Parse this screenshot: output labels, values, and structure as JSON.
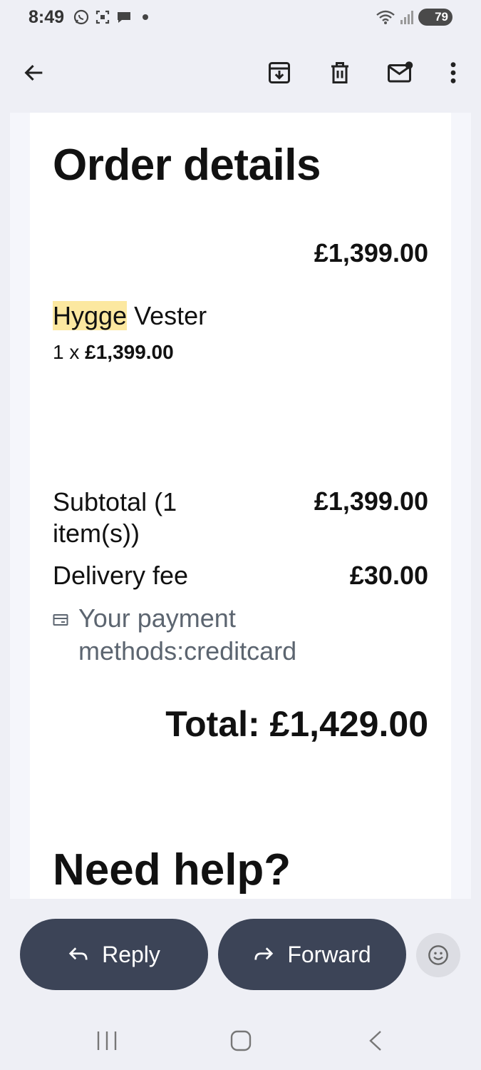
{
  "status_bar": {
    "time": "8:49",
    "battery": "79",
    "left_icons": [
      "whatsapp-icon",
      "screenshot-icon",
      "chat-icon",
      "dot-icon"
    ],
    "right_icons": [
      "wifi-icon",
      "signal-icon",
      "battery-icon"
    ]
  },
  "toolbar": {
    "icons": [
      "back-arrow-icon",
      "archive-icon",
      "delete-icon",
      "mark-unread-icon",
      "more-icon"
    ]
  },
  "email": {
    "heading": "Order details",
    "line_price": "£1,399.00",
    "item": {
      "highlighted_word": "Hygge",
      "rest_name": " Vester",
      "qty_prefix": "1 x ",
      "qty_price": "£1,399.00"
    },
    "subtotal_label": "Subtotal (1 item(s))",
    "subtotal_value": "£1,399.00",
    "delivery_label": "Delivery fee",
    "delivery_value": "£30.00",
    "payment_text": "Your payment methods:creditcard",
    "total": "Total: £1,429.00",
    "help_heading": "Need help?"
  },
  "actions": {
    "reply_label": "Reply",
    "forward_label": "Forward"
  },
  "colors": {
    "background": "#eeeff5",
    "button": "#3c4457",
    "highlight": "#fce8a0",
    "muted_text": "#5c6570"
  }
}
